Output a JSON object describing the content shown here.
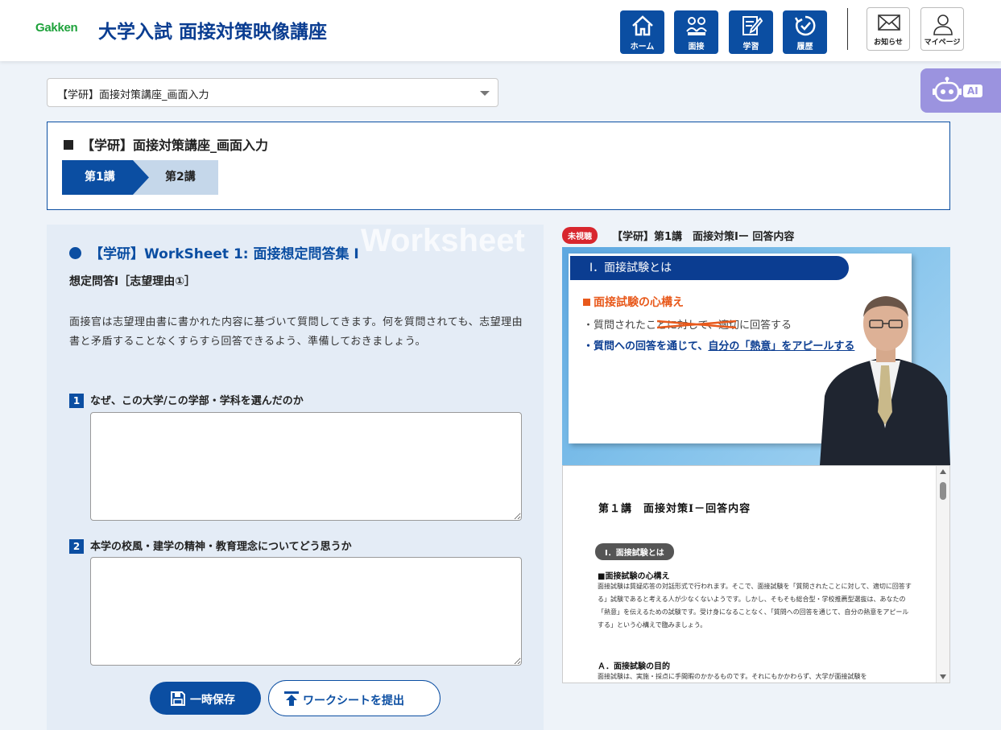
{
  "header": {
    "logo": "Gakken",
    "title": "大学入試 面接対策映像講座",
    "nav": [
      {
        "label": "ホーム",
        "icon": "home-icon"
      },
      {
        "label": "面接",
        "icon": "interview-icon"
      },
      {
        "label": "学習",
        "icon": "study-icon"
      },
      {
        "label": "履歴",
        "icon": "history-icon"
      }
    ],
    "utility": [
      {
        "label": "お知らせ",
        "icon": "mail-icon"
      },
      {
        "label": "マイページ",
        "icon": "user-icon"
      }
    ]
  },
  "ai_tab": {
    "label": "AI"
  },
  "course_select": {
    "value": "【学研】面接対策講座_画面入力"
  },
  "course_panel": {
    "title": "【学研】面接対策講座_画面入力",
    "steps": [
      {
        "label": "第1講",
        "active": true
      },
      {
        "label": "第2講",
        "active": false
      }
    ]
  },
  "worksheet": {
    "watermark": "Worksheet",
    "title": "【学研】WorkSheet 1: 面接想定問答集 Ⅰ",
    "subtitle": "想定問答Ⅰ［志望理由①］",
    "description": "面接官は志望理由書に書かれた内容に基づいて質問してきます。何を質問されても、志望理由書と矛盾することなくすらすら回答できるよう、準備しておきましょう。",
    "questions": [
      {
        "num": "1",
        "label": "なぜ、この大学/この学部・学科を選んだのか",
        "answer": ""
      },
      {
        "num": "2",
        "label": "本学の校風・建学の精神・教育理念についてどう思うか",
        "answer": ""
      }
    ],
    "save_label": "一時保存",
    "submit_label": "ワークシートを提出"
  },
  "video": {
    "status_badge": "未視聴",
    "title": "【学研】第1講　面接対策Ⅰー 回答内容",
    "slide": {
      "heading": "Ⅰ．面接試験とは",
      "subheading": "面接試験の心構え",
      "line1": "・質問されたことに対して、適切に回答する",
      "line2_prefix": "・質問への回答を通じて、",
      "line2_emph": "自分の「熱意」をアピールする"
    }
  },
  "document": {
    "title": "第１講　面接対策Ⅰ－回答内容",
    "section_pill": "Ⅰ．面接試験とは",
    "h1": "■面接試験の心構え",
    "p1": "面接試験は質疑応答の対話形式で行われます。そこで、面接試験を「質問されたことに対して、適切に回答する」試験であると考える人が少なくないようです。しかし、そもそも総合型・学校推薦型選抜は、あなたの「熱意」を伝えるための試験です。受け身になることなく、「質問への回答を通じて、自分の熱意をアピールする」という心構えで臨みましょう。",
    "h2": "Ａ．面接試験の目的",
    "p2": "面接試験は、実施・採点に手間暇のかかるものです。それにもかかわらず、大学が面接試験を"
  },
  "colors": {
    "primary": "#0b4ea2",
    "accent_red": "#d8262e",
    "ai_purple": "#9b93df",
    "logo_green": "#1ea23b"
  }
}
